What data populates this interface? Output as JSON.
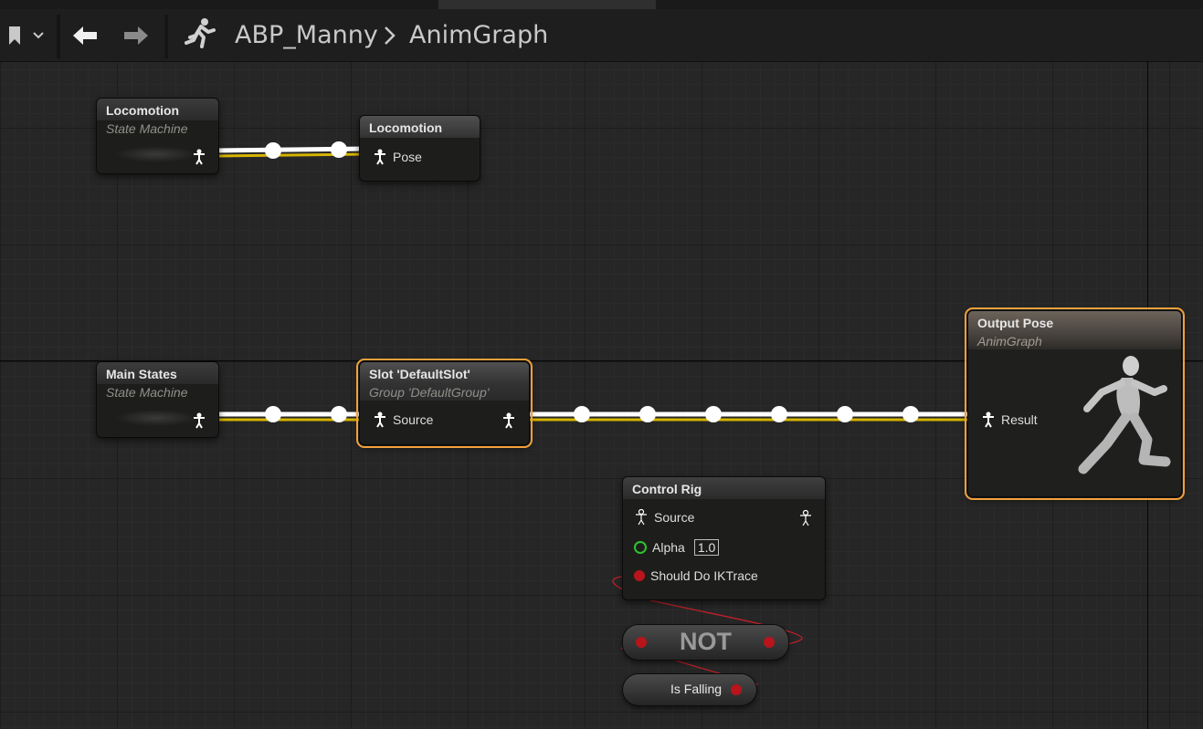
{
  "toolbar": {
    "bookmark_icon": "bookmark-icon",
    "back_icon": "arrow-left-icon",
    "forward_icon": "arrow-right-icon",
    "anim_icon": "running-figure-icon",
    "breadcrumb": [
      "ABP_Manny",
      "AnimGraph"
    ]
  },
  "nodes": {
    "locomotion_sm": {
      "title": "Locomotion",
      "subtitle": "State Machine"
    },
    "locomotion_pose": {
      "title": "Locomotion",
      "pin": "Pose"
    },
    "main_states": {
      "title": "Main States",
      "subtitle": "State Machine"
    },
    "slot": {
      "title": "Slot 'DefaultSlot'",
      "subtitle": "Group 'DefaultGroup'",
      "pin": "Source"
    },
    "output_pose": {
      "title": "Output Pose",
      "subtitle": "AnimGraph",
      "pin": "Result"
    },
    "control_rig": {
      "title": "Control Rig",
      "source_pin": "Source",
      "alpha_pin": "Alpha",
      "alpha_value": "1.0",
      "ik_pin": "Should Do IKTrace"
    },
    "not_node": {
      "label": "NOT"
    },
    "is_falling": {
      "label": "Is Falling"
    }
  },
  "colors": {
    "exec_wire": "#ffffff",
    "pose_wire_accent": "#d6b400",
    "bool_pin": "#b8141c",
    "float_pin": "#2ec22e",
    "selection": "#f3a13b"
  }
}
